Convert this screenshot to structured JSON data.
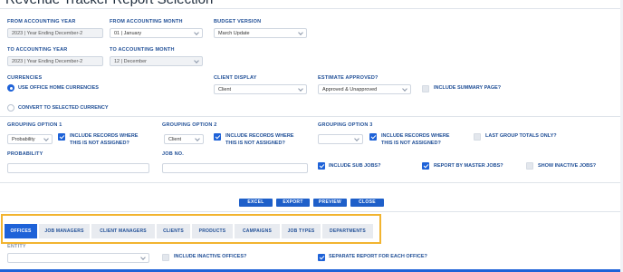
{
  "page": {
    "title": "Revenue Tracker Report Selection"
  },
  "from_year": {
    "label": "FROM ACCOUNTING YEAR",
    "value": "2023 | Year Ending December-2"
  },
  "from_month": {
    "label": "FROM ACCOUNTING MONTH",
    "value": "01 | January"
  },
  "budget_version": {
    "label": "BUDGET VERSION",
    "value": "March Update"
  },
  "to_year": {
    "label": "TO ACCOUNTING YEAR",
    "value": "2023 | Year Ending December-2"
  },
  "to_month": {
    "label": "TO ACCOUNTING MONTH",
    "value": "12 | December"
  },
  "currencies": {
    "label": "CURRENCIES",
    "option1": "USE OFFICE HOME CURRENCIES",
    "option2": "CONVERT TO SELECTED CURRENCY"
  },
  "client_display": {
    "label": "CLIENT DISPLAY",
    "value": "Client"
  },
  "estimate_approved": {
    "label": "ESTIMATE APPROVED?",
    "value": "Approved & Unapproved"
  },
  "include_summary": {
    "label": "INCLUDE SUMMARY PAGE?",
    "checked": false
  },
  "grouping1": {
    "label": "GROUPING OPTION 1",
    "value": "Probability",
    "cb_line1": "INCLUDE RECORDS WHERE",
    "cb_line2": "THIS IS NOT ASSIGNED?",
    "checked": true
  },
  "grouping2": {
    "label": "GROUPING OPTION 2",
    "value": "Client",
    "cb_line1": "INCLUDE RECORDS WHERE",
    "cb_line2": "THIS IS NOT ASSIGNED?",
    "checked": true
  },
  "grouping3": {
    "label": "GROUPING OPTION 3",
    "value": "",
    "cb_line1": "INCLUDE RECORDS WHERE",
    "cb_line2": "THIS IS NOT ASSIGNED?",
    "checked": true
  },
  "last_group_totals": {
    "label": "LAST GROUP TOTALS ONLY?",
    "checked": false
  },
  "probability": {
    "label": "PROBABILITY",
    "value": ""
  },
  "job_no": {
    "label": "JOB NO.",
    "value": ""
  },
  "include_sub_jobs": {
    "label": "INCLUDE SUB JOBS?",
    "checked": true
  },
  "report_by_master": {
    "label": "REPORT BY MASTER JOBS?",
    "checked": true
  },
  "show_inactive_jobs": {
    "label": "SHOW INACTIVE JOBS?",
    "checked": false
  },
  "actions": {
    "excel": "EXCEL",
    "export": "EXPORT",
    "preview": "PREVIEW",
    "close": "CLOSE"
  },
  "tabs": [
    "OFFICES",
    "JOB MANAGERS",
    "CLIENT MANAGERS",
    "CLIENTS",
    "PRODUCTS",
    "CAMPAIGNS",
    "JOB TYPES",
    "DEPARTMENTS"
  ],
  "active_tab": "OFFICES",
  "entity": {
    "label": "ENTITY",
    "value": ""
  },
  "include_inactive_offices": {
    "label": "INCLUDE INACTIVE OFFICES?",
    "checked": false
  },
  "separate_report": {
    "label": "SEPARATE REPORT FOR EACH OFFICE?",
    "checked": true
  },
  "colors": {
    "accent": "#1e62d8",
    "label_blue": "#1f4e96",
    "highlight": "#f2b430"
  }
}
